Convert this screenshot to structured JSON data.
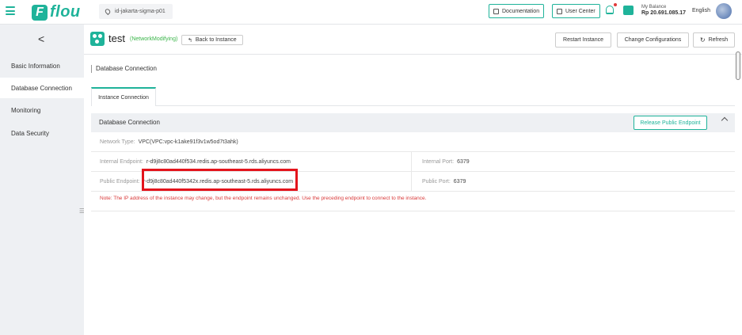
{
  "topbar": {
    "brand": "flou",
    "brand_letter": "F",
    "region": "id-jakarta-sigma-p01",
    "documentation": "Documentation",
    "user_center": "User Center",
    "balance_label": "My Balance",
    "balance_value": "Rp 20.691.085.17",
    "language": "English"
  },
  "sidebar": {
    "collapse": "<",
    "items": [
      {
        "label": "Basic Information"
      },
      {
        "label": "Database Connection"
      },
      {
        "label": "Monitoring"
      },
      {
        "label": "Data Security"
      }
    ],
    "toggle": "☰"
  },
  "instance": {
    "name": "test",
    "status": "(NetworkModifying)",
    "back": "Back to Instance",
    "back_icon": "↰",
    "restart": "Restart Instance",
    "change_config": "Change Configurations",
    "refresh": "Refresh",
    "refresh_icon": "↻"
  },
  "page": {
    "section": "Database Connection",
    "tab": "Instance Connection"
  },
  "connection": {
    "title": "Database Connection",
    "release": "Release Public Endpoint",
    "network_label": "Network Type:",
    "network_value": "VPC(VPC:vpc-k1ake91f3v1w5od7t3ahk)",
    "internal_endpoint_label": "Internal Endpoint:",
    "internal_endpoint_value": "r-d9j8c80ad440f534.redis.ap-southeast-5.rds.aliyuncs.com",
    "internal_port_label": "Internal Port:",
    "internal_port_value": "6379",
    "public_endpoint_label": "Public Endpoint:",
    "public_endpoint_value": "r-d9j8c80ad440f5342x.redis.ap-southeast-5.rds.aliyuncs.com",
    "public_port_label": "Public Port:",
    "public_port_value": "6379",
    "note": "Note:  The IP address of the instance may change, but the endpoint remains unchanged. Use the preceding endpoint to connect to the instance."
  },
  "colors": {
    "accent": "#1fb39a",
    "highlight": "#e3141c",
    "note": "#d93a3a",
    "status": "#3bb54a"
  }
}
